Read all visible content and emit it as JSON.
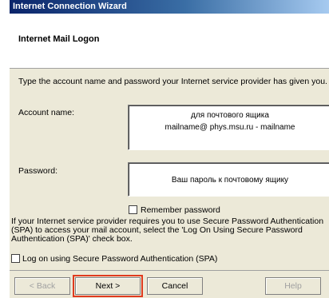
{
  "window": {
    "title": "Internet Connection Wizard"
  },
  "header": {
    "title": "Internet Mail Logon"
  },
  "body": {
    "instructions": "Type the account name and password your Internet service provider has given you.",
    "account_label": "Account name:",
    "account_value_line1": "для почтового ящика",
    "account_value_line2": "mailname@ phys.msu.ru -  mailname",
    "password_label": "Password:",
    "password_value": "Ваш пароль к почтовому ящику",
    "remember_label": "Remember password",
    "remember_checked": false,
    "spa_text": "If your Internet service provider requires you to use Secure Password Authentication (SPA) to access your mail account, select the 'Log On Using Secure Password Authentication (SPA)' check box.",
    "spa_label": "Log on using Secure Password Authentication (SPA)",
    "spa_checked": false
  },
  "buttons": {
    "back": "< Back",
    "next": "Next >",
    "cancel": "Cancel",
    "help": "Help"
  },
  "colors": {
    "highlight": "#e03a1e",
    "titlebar": "#0a246a",
    "dialog_bg": "#ece9d8"
  }
}
